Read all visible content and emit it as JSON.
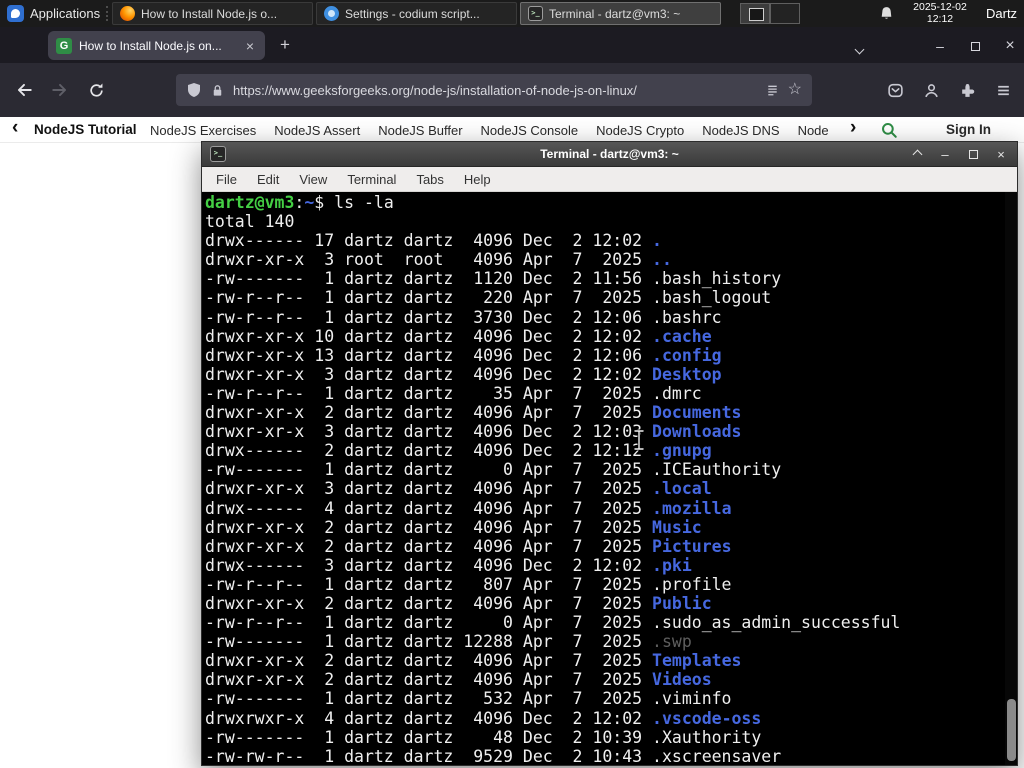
{
  "panel": {
    "applications_label": "Applications",
    "clock_date": "2025-12-02",
    "clock_time": "12:12",
    "user_name": "Dartz",
    "windows": [
      {
        "title": "How to Install Node.js o...",
        "icon": "firefox",
        "active": false
      },
      {
        "title": "Settings - codium script...",
        "icon": "codium",
        "active": false
      },
      {
        "title": "Terminal - dartz@vm3: ~",
        "icon": "terminal",
        "active": true
      }
    ]
  },
  "browser": {
    "tab_title": "How to Install Node.js on...",
    "favicon_letter": "G",
    "url": "https://www.geeksforgeeks.org/node-js/installation-of-node-js-on-linux/"
  },
  "gfg": {
    "primary_link": "NodeJS Tutorial",
    "links": [
      "NodeJS Exercises",
      "NodeJS Assert",
      "NodeJS Buffer",
      "NodeJS Console",
      "NodeJS Crypto",
      "NodeJS DNS",
      "Node"
    ],
    "sign_in_label": "Sign In"
  },
  "terminal_window": {
    "title": "Terminal - dartz@vm3: ~",
    "menu": [
      "File",
      "Edit",
      "View",
      "Terminal",
      "Tabs",
      "Help"
    ],
    "lines": [
      [
        [
          "g",
          "dartz@vm3"
        ],
        [
          "w",
          ":"
        ],
        [
          "b",
          "~"
        ],
        [
          "w",
          "$ ls -la"
        ]
      ],
      [
        [
          "w",
          "total 140"
        ]
      ],
      [
        [
          "w",
          "drwx------ 17 dartz dartz  4096 Dec  2 12:02 "
        ],
        [
          "b",
          "."
        ]
      ],
      [
        [
          "w",
          "drwxr-xr-x  3 root  root   4096 Apr  7  2025 "
        ],
        [
          "b",
          ".."
        ]
      ],
      [
        [
          "w",
          "-rw-------  1 dartz dartz  1120 Dec  2 11:56 .bash_history"
        ]
      ],
      [
        [
          "w",
          "-rw-r--r--  1 dartz dartz   220 Apr  7  2025 .bash_logout"
        ]
      ],
      [
        [
          "w",
          "-rw-r--r--  1 dartz dartz  3730 Dec  2 12:06 .bashrc"
        ]
      ],
      [
        [
          "w",
          "drwxr-xr-x 10 dartz dartz  4096 Dec  2 12:02 "
        ],
        [
          "b",
          ".cache"
        ]
      ],
      [
        [
          "w",
          "drwxr-xr-x 13 dartz dartz  4096 Dec  2 12:06 "
        ],
        [
          "b",
          ".config"
        ]
      ],
      [
        [
          "w",
          "drwxr-xr-x  3 dartz dartz  4096 Dec  2 12:02 "
        ],
        [
          "b",
          "Desktop"
        ]
      ],
      [
        [
          "w",
          "-rw-r--r--  1 dartz dartz    35 Apr  7  2025 .dmrc"
        ]
      ],
      [
        [
          "w",
          "drwxr-xr-x  2 dartz dartz  4096 Apr  7  2025 "
        ],
        [
          "b",
          "Documents"
        ]
      ],
      [
        [
          "w",
          "drwxr-xr-x  3 dartz dartz  4096 Dec  2 12:03 "
        ],
        [
          "b",
          "Downloads"
        ]
      ],
      [
        [
          "w",
          "drwx------  2 dartz dartz  4096 Dec  2 12:12 "
        ],
        [
          "b",
          ".gnupg"
        ]
      ],
      [
        [
          "w",
          "-rw-------  1 dartz dartz     0 Apr  7  2025 .ICEauthority"
        ]
      ],
      [
        [
          "w",
          "drwxr-xr-x  3 dartz dartz  4096 Apr  7  2025 "
        ],
        [
          "b",
          ".local"
        ]
      ],
      [
        [
          "w",
          "drwx------  4 dartz dartz  4096 Apr  7  2025 "
        ],
        [
          "b",
          ".mozilla"
        ]
      ],
      [
        [
          "w",
          "drwxr-xr-x  2 dartz dartz  4096 Apr  7  2025 "
        ],
        [
          "b",
          "Music"
        ]
      ],
      [
        [
          "w",
          "drwxr-xr-x  2 dartz dartz  4096 Apr  7  2025 "
        ],
        [
          "b",
          "Pictures"
        ]
      ],
      [
        [
          "w",
          "drwx------  3 dartz dartz  4096 Dec  2 12:02 "
        ],
        [
          "b",
          ".pki"
        ]
      ],
      [
        [
          "w",
          "-rw-r--r--  1 dartz dartz   807 Apr  7  2025 .profile"
        ]
      ],
      [
        [
          "w",
          "drwxr-xr-x  2 dartz dartz  4096 Apr  7  2025 "
        ],
        [
          "b",
          "Public"
        ]
      ],
      [
        [
          "w",
          "-rw-r--r--  1 dartz dartz     0 Apr  7  2025 .sudo_as_admin_successful"
        ]
      ],
      [
        [
          "w",
          "-rw-------  1 dartz dartz 12288 Apr  7  2025 "
        ],
        [
          "d",
          ".swp"
        ]
      ],
      [
        [
          "w",
          "drwxr-xr-x  2 dartz dartz  4096 Apr  7  2025 "
        ],
        [
          "b",
          "Templates"
        ]
      ],
      [
        [
          "w",
          "drwxr-xr-x  2 dartz dartz  4096 Apr  7  2025 "
        ],
        [
          "b",
          "Videos"
        ]
      ],
      [
        [
          "w",
          "-rw-------  1 dartz dartz   532 Apr  7  2025 .viminfo"
        ]
      ],
      [
        [
          "w",
          "drwxrwxr-x  4 dartz dartz  4096 Dec  2 12:02 "
        ],
        [
          "b",
          ".vscode-oss"
        ]
      ],
      [
        [
          "w",
          "-rw-------  1 dartz dartz    48 Dec  2 10:39 .Xauthority"
        ]
      ],
      [
        [
          "w",
          "-rw-rw-r--  1 dartz dartz  9529 Dec  2 10:43 .xscreensaver"
        ]
      ]
    ]
  },
  "icons": {
    "new_tab": "+",
    "tab_close": "×",
    "window_minimize": "–",
    "window_close": "×",
    "star": "☆",
    "chevron_left": "‹",
    "chevron_right": "›",
    "terminal_glyph": ">_"
  },
  "colors": {
    "gfg_green": "#2f8d46",
    "terminal_dir_blue": "#4668e0",
    "terminal_prompt_green": "#44cf44",
    "panel_background": "#1b1b1b",
    "browser_toolbar": "#2b2a33"
  }
}
